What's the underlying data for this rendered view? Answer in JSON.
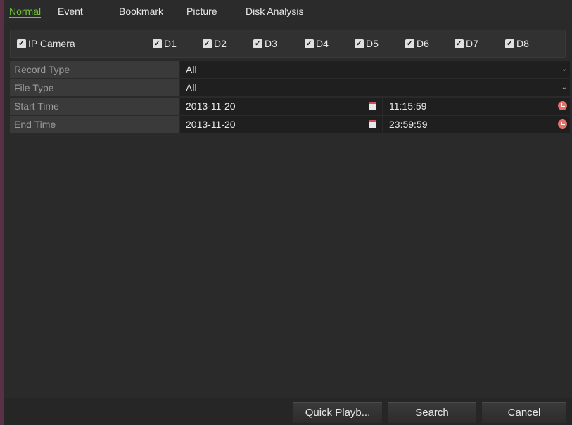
{
  "tabs": [
    {
      "label": "Normal",
      "active": true
    },
    {
      "label": "Event"
    },
    {
      "label": "Bookmark"
    },
    {
      "label": "Picture"
    },
    {
      "label": "Disk Analysis"
    }
  ],
  "cameras": {
    "group_label": "IP Camera",
    "group_checked": true,
    "channels": [
      {
        "label": "D1",
        "checked": true
      },
      {
        "label": "D2",
        "checked": true
      },
      {
        "label": "D3",
        "checked": true
      },
      {
        "label": "D4",
        "checked": true
      },
      {
        "label": "D5",
        "checked": true
      },
      {
        "label": "D6",
        "checked": true
      },
      {
        "label": "D7",
        "checked": true
      },
      {
        "label": "D8",
        "checked": true
      }
    ]
  },
  "form": {
    "record_type": {
      "label": "Record Type",
      "value": "All"
    },
    "file_type": {
      "label": "File Type",
      "value": "All"
    },
    "start_time": {
      "label": "Start Time",
      "date": "2013-11-20",
      "time": "11:15:59"
    },
    "end_time": {
      "label": "End Time",
      "date": "2013-11-20",
      "time": "23:59:59"
    }
  },
  "buttons": {
    "quick_playback": "Quick Playb...",
    "search": "Search",
    "cancel": "Cancel"
  },
  "colors": {
    "accent_active_tab": "#73c639",
    "side_border": "#5a3046"
  },
  "icons": {
    "checkbox": "checkmark-icon",
    "dropdown": "chevron-down-icon",
    "date": "calendar-icon",
    "time": "clock-icon"
  }
}
